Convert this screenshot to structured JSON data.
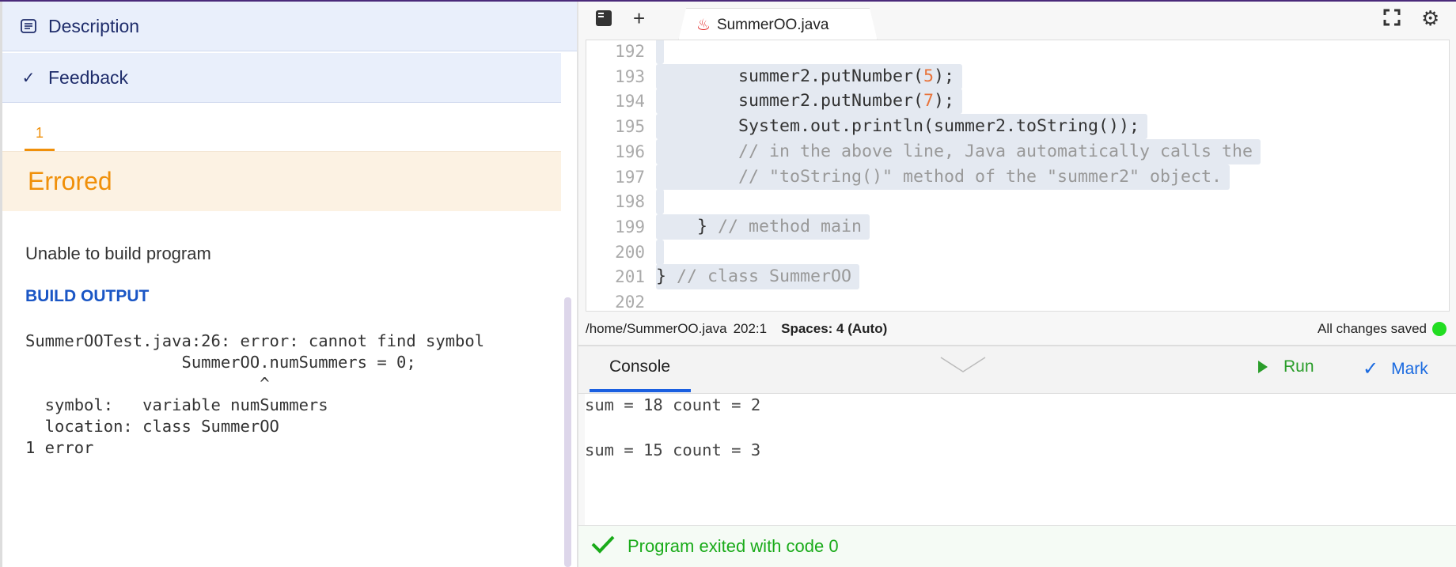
{
  "left_panel": {
    "description_label": "Description",
    "feedback_label": "Feedback",
    "attempt_tab": "1",
    "status": "Errored",
    "message": "Unable to build program",
    "build_output_heading": "BUILD OUTPUT",
    "build_output": "SummerOOTest.java:26: error: cannot find symbol\n                SummerOO.numSummers = 0;\n                        ^\n  symbol:   variable numSummers\n  location: class SummerOO\n1 error"
  },
  "editor": {
    "file_tab": "SummerOO.java",
    "lines": [
      {
        "n": "192",
        "code": ""
      },
      {
        "n": "193",
        "pre": "        summer2.putNumber(",
        "num": "5",
        "post": ");"
      },
      {
        "n": "194",
        "pre": "        summer2.putNumber(",
        "num": "7",
        "post": ");"
      },
      {
        "n": "195",
        "code": "        System.out.println(summer2.toString());"
      },
      {
        "n": "196",
        "code": "        ",
        "comment": "// in the above line, Java automatically calls the"
      },
      {
        "n": "197",
        "code": "        ",
        "comment": "// \"toString()\" method of the \"summer2\" object."
      },
      {
        "n": "198",
        "code": ""
      },
      {
        "n": "199",
        "code": "    } ",
        "comment": "// method main"
      },
      {
        "n": "200",
        "code": ""
      },
      {
        "n": "201",
        "code": "} ",
        "comment": "// class SummerOO"
      },
      {
        "n": "202",
        "code": ""
      }
    ],
    "status": {
      "path": "/home/SummerOO.java",
      "cursor": "202:1",
      "spaces": "Spaces: 4 (Auto)",
      "saved": "All changes saved"
    }
  },
  "console": {
    "tab": "Console",
    "run_label": "Run",
    "mark_label": "Mark",
    "output": [
      "sum = 18 count = 2",
      "sum = 15 count = 3"
    ],
    "exit_message": "Program exited with code 0"
  },
  "colors": {
    "accent_orange": "#f0900a",
    "link_blue": "#1a56c5",
    "success_green": "#1aab1a",
    "saved_dot": "#22dd22"
  }
}
